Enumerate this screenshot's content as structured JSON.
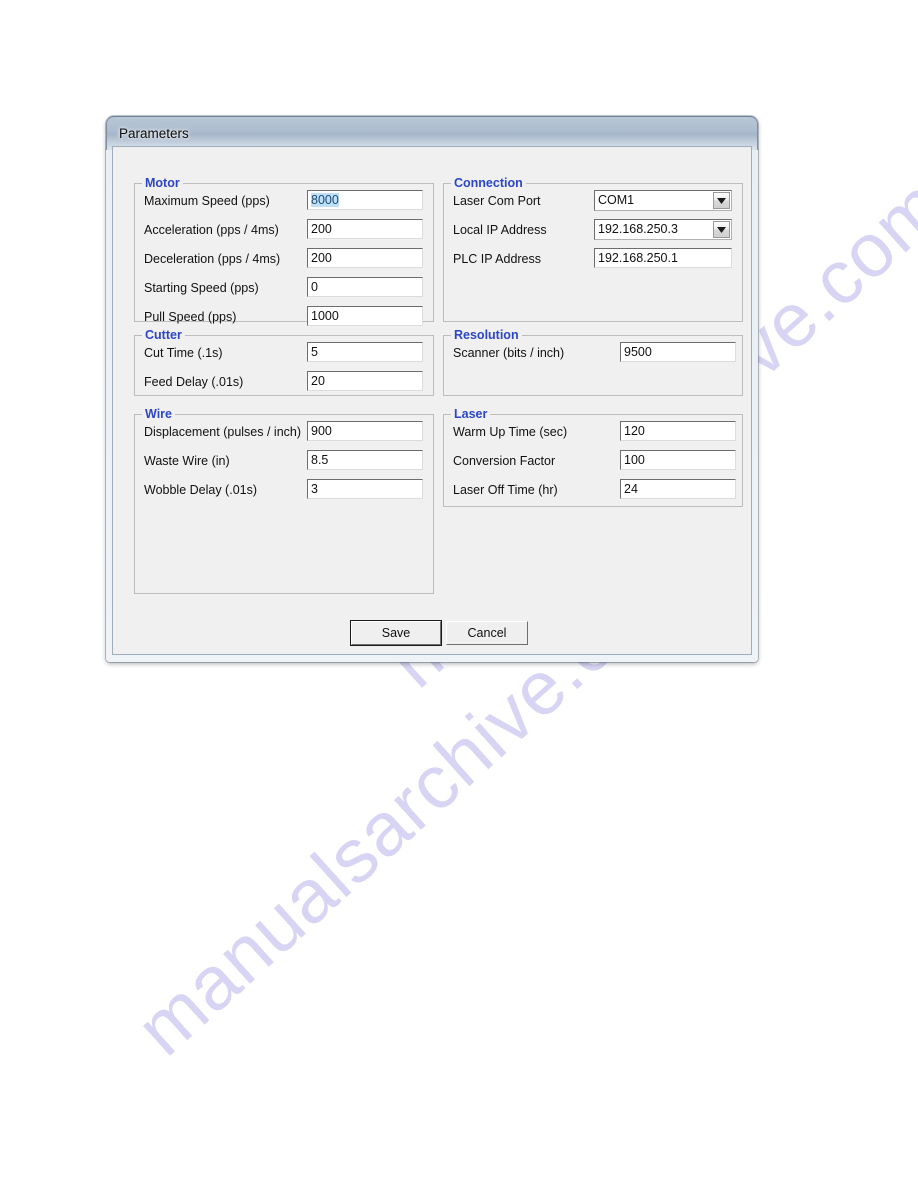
{
  "watermark": {
    "line1": "manualsarchive.com",
    "line2": "manualsarchive.com",
    "color": "#c9c6ef"
  },
  "window": {
    "title": "Parameters",
    "accent_color": "#2d46c8",
    "client_bg": "#f0f0f0"
  },
  "groups": {
    "motor": {
      "legend": "Motor",
      "fields": [
        {
          "label": "Maximum Speed (pps)",
          "value": "8000",
          "selected": true
        },
        {
          "label": "Acceleration (pps / 4ms)",
          "value": "200",
          "selected": false
        },
        {
          "label": "Deceleration (pps / 4ms)",
          "value": "200",
          "selected": false
        },
        {
          "label": "Starting Speed (pps)",
          "value": "0",
          "selected": false
        },
        {
          "label": "Pull Speed (pps)",
          "value": "1000",
          "selected": false
        }
      ]
    },
    "cutter": {
      "legend": "Cutter",
      "fields": [
        {
          "label": "Cut Time (.1s)",
          "value": "5"
        },
        {
          "label": "Feed Delay (.01s)",
          "value": "20"
        }
      ]
    },
    "wire": {
      "legend": "Wire",
      "fields": [
        {
          "label": "Displacement (pulses / inch)",
          "value": "900"
        },
        {
          "label": "Waste Wire (in)",
          "value": "8.5"
        },
        {
          "label": "Wobble Delay (.01s)",
          "value": "3"
        }
      ]
    },
    "connection": {
      "legend": "Connection",
      "fields": [
        {
          "label": "Laser Com Port",
          "value": "COM1",
          "type": "combobox"
        },
        {
          "label": "Local IP Address",
          "value": "192.168.250.3",
          "type": "combobox"
        },
        {
          "label": "PLC IP Address",
          "value": "192.168.250.1",
          "type": "textbox"
        }
      ]
    },
    "resolution": {
      "legend": "Resolution",
      "fields": [
        {
          "label": "Scanner (bits / inch)",
          "value": "9500"
        }
      ]
    },
    "laser": {
      "legend": "Laser",
      "fields": [
        {
          "label": "Warm Up Time (sec)",
          "value": "120"
        },
        {
          "label": "Conversion Factor",
          "value": "100"
        },
        {
          "label": "Laser Off Time (hr)",
          "value": "24"
        }
      ]
    }
  },
  "buttons": {
    "save": "Save",
    "cancel": "Cancel"
  }
}
